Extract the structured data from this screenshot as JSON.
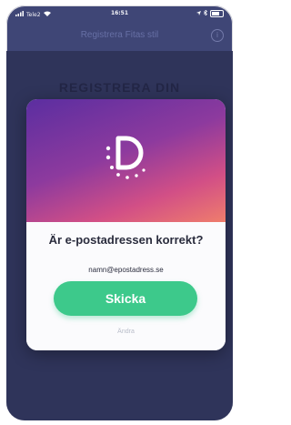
{
  "status_bar": {
    "carrier": "Tele2",
    "time": "16:51"
  },
  "nav": {
    "title": "Registrera Fitas stil",
    "info_icon": "info-icon"
  },
  "screen": {
    "title": "REGISTRERA DIN"
  },
  "modal": {
    "question": "Är e-postadressen korrekt?",
    "email": "namn@epostadress.se",
    "send_label": "Skicka",
    "cancel_label": "Ändra",
    "logo_icon": "brand-logo-icon"
  },
  "colors": {
    "send_button": "#3dc98b",
    "background": "#3f4676",
    "gradient_start": "#5b2ea0",
    "gradient_end": "#ef7d6c"
  }
}
